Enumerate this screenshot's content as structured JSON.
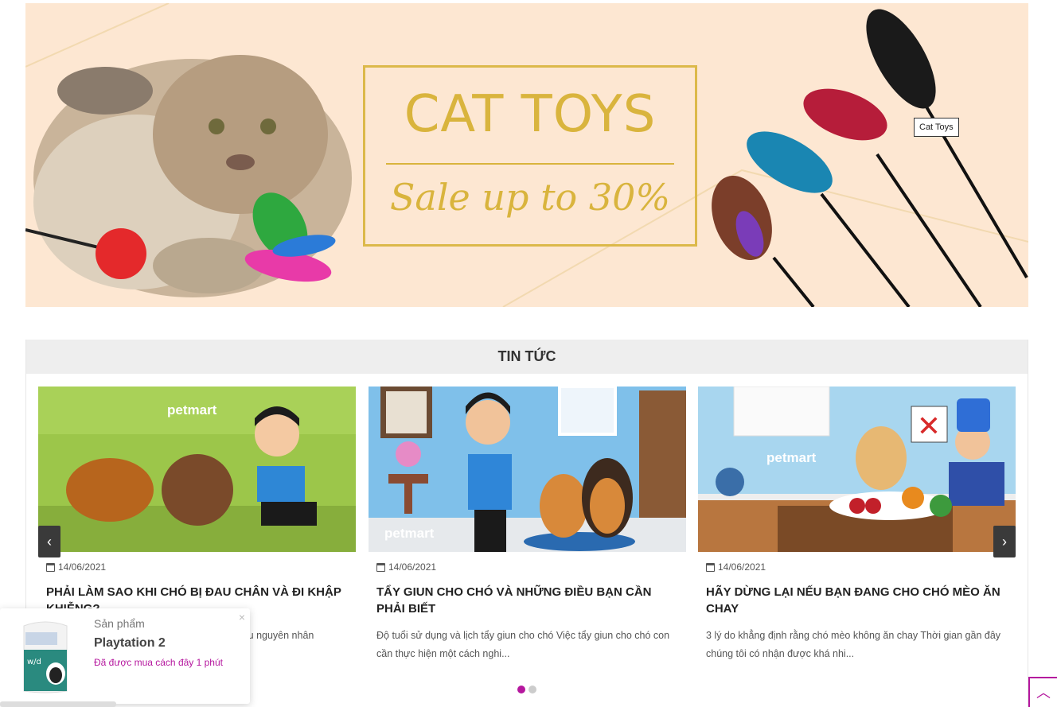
{
  "banner": {
    "title": "CAT TOYS",
    "subtitle": "Sale up to 30%",
    "tooltip": "Cat Toys"
  },
  "news": {
    "heading": "TIN TỨC",
    "prev_icon": "chevron-left-icon",
    "next_icon": "chevron-right-icon",
    "cards": [
      {
        "date": "14/06/2021",
        "title": "PHẢI LÀM SAO KHI CHÓ BỊ ĐAU CHÂN VÀ ĐI KHẬP KHIỄNG?",
        "desc": "Chó bị đau chân và đi khập khiễng có rất nhiều nguyên nhân",
        "image_label": "petmart"
      },
      {
        "date": "14/06/2021",
        "title": "TẨY GIUN CHO CHÓ VÀ NHỮNG ĐIỀU BẠN CẦN PHẢI BIẾT",
        "desc": "Độ tuổi sử dụng và lịch tẩy giun cho chó Việc tẩy giun cho chó con cần thực hiện một cách nghi...",
        "image_label": "petmart"
      },
      {
        "date": "14/06/2021",
        "title": "HÃY DỪNG LẠI NẾU BẠN ĐANG CHO CHÓ MÈO ĂN CHAY",
        "desc": "3 lý do khẳng định rằng chó mèo không ăn chay Thời gian gần đây chúng tôi có nhận được khá nhi...",
        "image_label": "petmart"
      }
    ],
    "active_dot_color": "#b5179e"
  },
  "popup": {
    "label": "Sản phẩm",
    "product": "Playtation 2",
    "time": "Đã được mua cách đây 1 phút",
    "close": "×",
    "bag_text": "w/d"
  },
  "scroll_top": "︿",
  "colors": {
    "accent": "#b5179e",
    "banner_bg": "#fde7d2",
    "gold": "#d9b43d"
  }
}
